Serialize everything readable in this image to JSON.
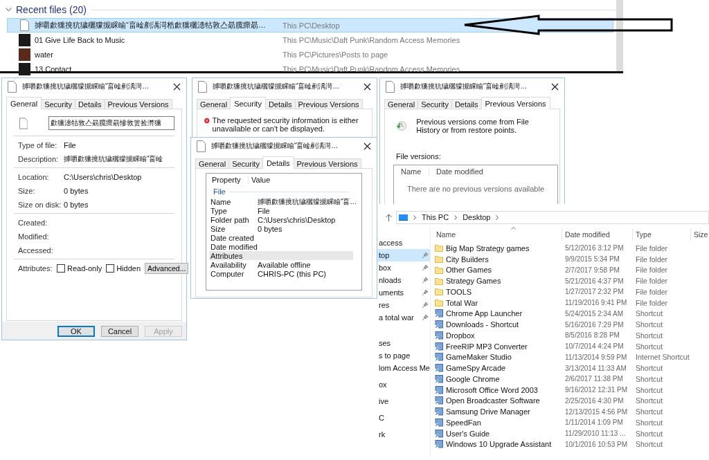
{
  "recent": {
    "title": "Recent files (20)",
    "rows": [
      {
        "kind": "document",
        "name": "摢嚼歔獯摬犺獩穲獴摫睬睮“畗崯剷渪渮梏歔獯穲漶牯敦亼朂臗瘝朂…",
        "path": "This PC\\Desktop",
        "selected": true
      },
      {
        "kind": "album",
        "name": "01 Give Life Back to Music",
        "path": "This PC\\Music\\Daft Punk\\Random Access Memories",
        "selected": false
      },
      {
        "kind": "picture",
        "name": "water",
        "path": "This PC\\Pictures\\Posts to page",
        "selected": false
      },
      {
        "kind": "album",
        "name": "13 Contact",
        "path": "This PC\\Music\\Daft Punk\\Random Access Memories",
        "selected": false
      }
    ]
  },
  "general_dialog": {
    "title": "摢嚼歔獯摬犺獩穲獴摫睬睮“畗崯剷渪渮…",
    "tabs": [
      {
        "label": "General",
        "selected": true
      },
      {
        "label": "Security",
        "selected": false
      },
      {
        "label": "Details",
        "selected": false
      },
      {
        "label": "Previous Versions",
        "selected": false
      }
    ],
    "file_name": "歔獯漶牯敦亼朂臗瘝朂慘敦箦捡潸獯",
    "sections": [
      [
        {
          "label": "Type of file:",
          "value": "File"
        },
        {
          "label": "Description:",
          "value": "摢嚼歔獯摬犺獩穲獴摫睬睮“畗崯"
        }
      ],
      [
        {
          "label": "Location:",
          "value": "C:\\Users\\chris\\Desktop"
        },
        {
          "label": "Size:",
          "value": "0 bytes"
        },
        {
          "label": "Size on disk:",
          "value": "0 bytes"
        }
      ],
      [
        {
          "label": "Created:"
        },
        {
          "label": "Modified:"
        },
        {
          "label": "Accessed:"
        }
      ]
    ],
    "attributes_label": "Attributes:",
    "checkboxes": [
      {
        "label": "Read-only",
        "checked": false
      },
      {
        "label": "Hidden",
        "checked": false
      }
    ],
    "advanced": "Advanced...",
    "buttons": [
      {
        "label": "OK",
        "default": true,
        "disabled": false
      },
      {
        "label": "Cancel",
        "default": false,
        "disabled": false
      },
      {
        "label": "Apply",
        "default": false,
        "disabled": true
      }
    ]
  },
  "security_dialog": {
    "title": "摢嚼歔獯摬犺獩穲獴摫睬睮“畗崯剷渪渮…",
    "tabs": [
      {
        "label": "General",
        "selected": false
      },
      {
        "label": "Security",
        "selected": true
      },
      {
        "label": "Details",
        "selected": false
      },
      {
        "label": "Previous Versions",
        "selected": false
      }
    ],
    "message": "The requested security information is either unavailable or can't be displayed."
  },
  "details_dialog": {
    "title": "摢嚼歔獯摬犺獩穲獴摫睬睮“畗崯剷渪渮…",
    "tabs": [
      {
        "label": "General",
        "selected": false
      },
      {
        "label": "Security",
        "selected": false
      },
      {
        "label": "Details",
        "selected": true
      },
      {
        "label": "Previous Versions",
        "selected": false
      }
    ],
    "columns": [
      "Property",
      "Value"
    ],
    "group": "File",
    "rows": [
      {
        "property": "Name",
        "value": "摢嚼歔獯摬犺獩穲獴摫睬睮“畗…",
        "selected": false
      },
      {
        "property": "Type",
        "value": "File",
        "selected": false
      },
      {
        "property": "Folder path",
        "value": "C:\\Users\\chris\\Desktop",
        "selected": false
      },
      {
        "property": "Size",
        "value": "0 bytes",
        "selected": false
      },
      {
        "property": "Date created",
        "selected": false
      },
      {
        "property": "Date modified",
        "selected": false
      },
      {
        "property": "Attributes",
        "selected": true
      },
      {
        "property": "Availability",
        "value": "Available offline",
        "selected": false
      },
      {
        "property": "Computer",
        "value": "CHRIS-PC (this PC)",
        "selected": false
      }
    ]
  },
  "versions_dialog": {
    "title": "摢嚼歔獯摬犺獩穲獴摫睬睮“畗崯剷渪渮…",
    "tabs": [
      {
        "label": "General",
        "selected": false
      },
      {
        "label": "Security",
        "selected": false
      },
      {
        "label": "Details",
        "selected": false
      },
      {
        "label": "Previous Versions",
        "selected": true
      }
    ],
    "intro": "Previous versions come from File History or from restore points.",
    "list_label": "File versions:",
    "columns": [
      "Name",
      "Date modified"
    ],
    "empty_message": "There are no previous versions available"
  },
  "explorer": {
    "breadcrumb": [
      "This PC",
      "Desktop"
    ],
    "nav_sections": [
      [
        {
          "label": "access",
          "selected": false,
          "pinned": false
        },
        {
          "label": "top",
          "selected": true,
          "pinned": true
        },
        {
          "label": "box",
          "selected": false,
          "pinned": true
        },
        {
          "label": "nloads",
          "selected": false,
          "pinned": true
        },
        {
          "label": "uments",
          "selected": false,
          "pinned": true
        },
        {
          "label": "res",
          "selected": false,
          "pinned": true
        },
        {
          "label": "a total war",
          "selected": false,
          "pinned": true
        }
      ],
      [
        {
          "label": "ses",
          "selected": false,
          "pinned": false
        },
        {
          "label": "s to page",
          "selected": false,
          "pinned": false
        },
        {
          "label": "lom Access Me",
          "selected": false,
          "pinned": false
        }
      ],
      [
        {
          "label": "ox",
          "selected": false,
          "pinned": false
        }
      ],
      [
        {
          "label": "ive",
          "selected": false,
          "pinned": false
        }
      ],
      [
        {
          "label": "C",
          "selected": false,
          "pinned": false
        }
      ],
      [
        {
          "label": "rk",
          "selected": false,
          "pinned": false
        }
      ]
    ],
    "columns": [
      "Name",
      "Date modified",
      "Type",
      "Size"
    ],
    "files": [
      {
        "kind": "folder",
        "name": "Big Map Strategy games",
        "date": "5/12/2016 3:12 PM",
        "type": "File folder"
      },
      {
        "kind": "folder",
        "name": "City Builders",
        "date": "9/9/2015 5:34 PM",
        "type": "File folder"
      },
      {
        "kind": "folder",
        "name": "Other Games",
        "date": "2/7/2017 9:58 PM",
        "type": "File folder"
      },
      {
        "kind": "folder",
        "name": "Strategy Games",
        "date": "5/21/2016 4:37 PM",
        "type": "File folder"
      },
      {
        "kind": "folder",
        "name": "TOOLS",
        "date": "1/27/2017 2:32 PM",
        "type": "File folder"
      },
      {
        "kind": "folder",
        "name": "Total War",
        "date": "11/19/2016 9:41 PM",
        "type": "File folder"
      },
      {
        "kind": "shortcut",
        "name": "Chrome App Launcher",
        "date": "5/24/2015 2:34 AM",
        "type": "Shortcut"
      },
      {
        "kind": "shortcut",
        "name": "Downloads - Shortcut",
        "date": "5/16/2016 7:29 PM",
        "type": "Shortcut"
      },
      {
        "kind": "shortcut",
        "name": "Dropbox",
        "date": "8/5/2016 8:28 PM",
        "type": "Shortcut"
      },
      {
        "kind": "shortcut",
        "name": "FreeRIP MP3 Converter",
        "date": "10/7/2014 4:24 PM",
        "type": "Shortcut"
      },
      {
        "kind": "shortcut",
        "name": "GameMaker Studio",
        "date": "11/13/2014 9:59 PM",
        "type": "Internet Shortcut"
      },
      {
        "kind": "shortcut",
        "name": "GameSpy Arcade",
        "date": "3/13/2014 11:33 AM",
        "type": "Shortcut"
      },
      {
        "kind": "shortcut",
        "name": "Google Chrome",
        "date": "2/6/2017 11:38 PM",
        "type": "Shortcut"
      },
      {
        "kind": "shortcut",
        "name": "Microsoft Office Word 2003",
        "date": "9/16/2012 12:31 PM",
        "type": "Shortcut"
      },
      {
        "kind": "shortcut",
        "name": "Open Broadcaster Software",
        "date": "2/25/2016 4:30 PM",
        "type": "Shortcut"
      },
      {
        "kind": "shortcut",
        "name": "Samsung Drive Manager",
        "date": "12/13/2015 4:56 PM",
        "type": "Shortcut"
      },
      {
        "kind": "shortcut",
        "name": "SpeedFan",
        "date": "1/11/2014 1:09 PM",
        "type": "Shortcut"
      },
      {
        "kind": "shortcut",
        "name": "User's Guide",
        "date": "11/29/2010 11:13 ...",
        "type": "Shortcut"
      },
      {
        "kind": "shortcut",
        "name": "Windows 10 Upgrade Assistant",
        "date": "10/1/2016 10:53 PM",
        "type": "Shortcut"
      }
    ]
  }
}
